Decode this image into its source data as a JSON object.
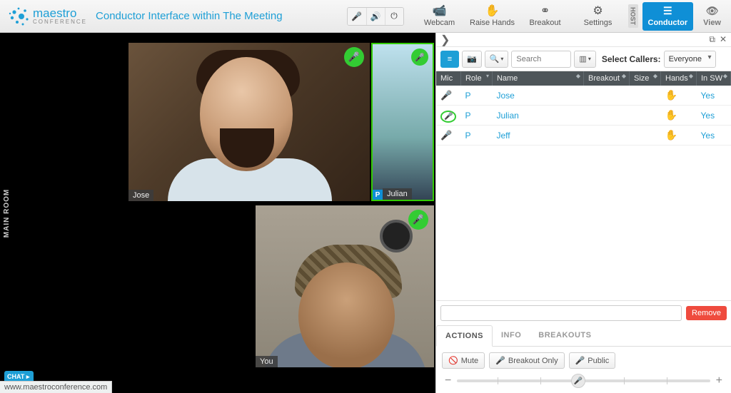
{
  "logo": {
    "line1": "maestro",
    "line2": "CONFERENCE"
  },
  "title": "Conductor Interface within The Meeting",
  "nav": {
    "webcam": "Webcam",
    "raise": "Raise Hands",
    "breakout": "Breakout",
    "settings": "Settings",
    "host": "HOST",
    "conductor": "Conductor",
    "view": "View"
  },
  "room_label": "MAIN ROOM",
  "participants": {
    "jose": "Jose",
    "julian": "Julian",
    "you": "You",
    "p_badge": "P"
  },
  "chat_tab": "CHAT",
  "status_url": "www.maestroconference.com",
  "toolbar": {
    "search_placeholder": "Search",
    "select_label": "Select Callers:",
    "select_value": "Everyone"
  },
  "columns": [
    "Mic",
    "Role",
    "Name",
    "Breakout",
    "Size",
    "Hands",
    "In SW"
  ],
  "rows": [
    {
      "role": "P",
      "name": "Jose",
      "insw": "Yes"
    },
    {
      "role": "P",
      "name": "Julian",
      "insw": "Yes"
    },
    {
      "role": "P",
      "name": "Jeff",
      "insw": "Yes"
    }
  ],
  "remove": "Remove",
  "tabs": {
    "actions": "ACTIONS",
    "info": "INFO",
    "breakouts": "BREAKOUTS"
  },
  "actions": {
    "mute": "Mute",
    "breakout_only": "Breakout Only",
    "public": "Public"
  },
  "slider": {
    "minus": "−",
    "plus": "+"
  }
}
